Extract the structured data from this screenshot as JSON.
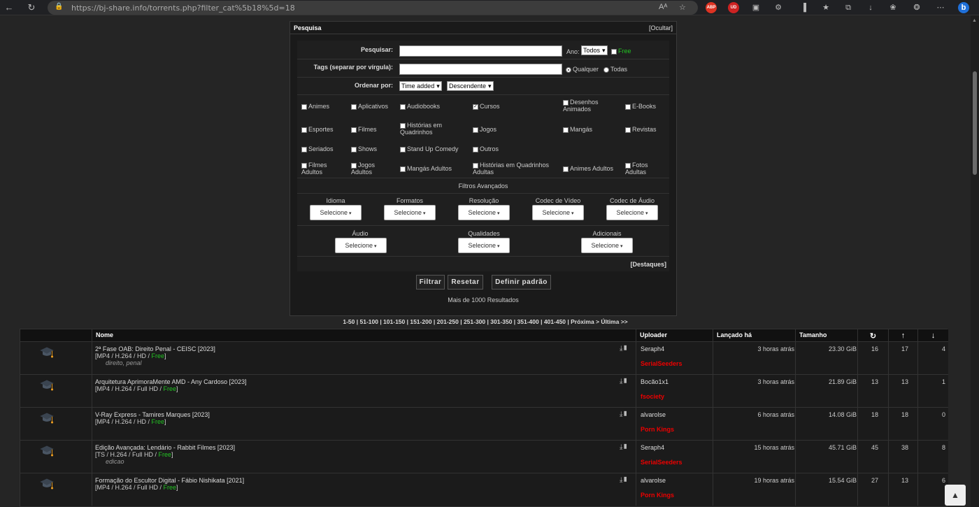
{
  "browser": {
    "url": "https://bj-share.info/torrents.php?filter_cat%5b18%5d=18",
    "back_icon": "←",
    "reload_icon": "↻",
    "lock_icon": "🔒",
    "read_aloud": "Aᴬ",
    "fav_icon": "☆",
    "menu_icon": "⋯",
    "extensions": [
      "ABP",
      "UD",
      "▣",
      "⚙",
      "▐",
      "★",
      "⧉",
      "↓",
      "❀",
      "❂"
    ]
  },
  "search": {
    "title": "Pesquisa",
    "hide": "[Ocultar]",
    "search_label": "Pesquisar:",
    "year_label": "Ano:",
    "year_value": "Todos",
    "free_label": "Free",
    "tags_label": "Tags (separar por vírgula):",
    "any_label": "Qualquer",
    "all_label": "Todas",
    "order_label": "Ordenar por:",
    "order_value": "Time added",
    "dir_value": "Descendente",
    "categories": [
      "Animes",
      "Aplicativos",
      "Audiobooks",
      "Cursos",
      "Desenhos Animados",
      "E-Books",
      "Esportes",
      "Filmes",
      "Histórias em Quadrinhos",
      "Jogos",
      "Mangás",
      "Revistas",
      "Seriados",
      "Shows",
      "Stand Up Comedy",
      "Outros",
      "Filmes Adultos",
      "Jogos Adultos",
      "Mangás Adultos",
      "Histórias em Quadrinhos Adultas",
      "Animes Adultos",
      "Fotos Adultas"
    ],
    "checked": "Cursos",
    "advanced": "Filtros Avançados",
    "filters": [
      "Idioma",
      "Formatos",
      "Resolução",
      "Codec de Vídeo",
      "Codec de Áudio",
      "Áudio",
      "Qualidades",
      "Adicionais"
    ],
    "select_label": "Selecione",
    "highlights": "[Destaques]",
    "filter_btn": "Filtrar",
    "reset_btn": "Resetar",
    "default_btn": "Definir padrão",
    "results": "Mais de 1000 Resultados"
  },
  "pager": "1-50 | 51-100 | 101-150 | 151-200 | 201-250 | 251-300 | 301-350 | 351-400 | 401-450 | Próxima > Última >>",
  "table": {
    "headers": {
      "name": "Nome",
      "uploader": "Uploader",
      "released": "Lançado há",
      "size": "Tamanho",
      "snatched": "↻",
      "seeders": "↑",
      "leechers": "↓"
    },
    "rows": [
      {
        "title": "2ª Fase OAB: Direito Penal - CEISC [2023]",
        "fmt": "[MP4 / H.264 / HD / ",
        "free": "Free",
        "tags": "direito, penal",
        "uploader": "Seraph4",
        "group": "SerialSeeders",
        "when": "3 horas atrás",
        "size": "23.30 GiB",
        "c1": "16",
        "c2": "17",
        "c3": "4"
      },
      {
        "title": "Arquitetura AprimoraMente AMD - Any Cardoso [2023]",
        "fmt": "[MP4 / H.264 / Full HD / ",
        "free": "Free",
        "tags": "",
        "uploader": "Bocão1x1",
        "group": "fsociety",
        "when": "3 horas atrás",
        "size": "21.89 GiB",
        "c1": "13",
        "c2": "13",
        "c3": "1"
      },
      {
        "title": "V-Ray Express - Tamires Marques [2023]",
        "fmt": "[MP4 / H.264 / HD / ",
        "free": "Free",
        "tags": "",
        "uploader": "alvarolse",
        "group": "Porn Kings",
        "when": "6 horas atrás",
        "size": "14.08 GiB",
        "c1": "18",
        "c2": "18",
        "c3": "0"
      },
      {
        "title": "Edição Avançada: Lendário - Rabbit Filmes [2023]",
        "fmt": "[TS / H.264 / Full HD / ",
        "free": "Free",
        "tags": "edicao",
        "uploader": "Seraph4",
        "group": "SerialSeeders",
        "when": "15 horas atrás",
        "size": "45.71 GiB",
        "c1": "45",
        "c2": "38",
        "c3": "8"
      },
      {
        "title": "Formação do Escultor Digital - Fábio Nishikata [2021]",
        "fmt": "[MP4 / H.264 / Full HD / ",
        "free": "Free",
        "tags": "",
        "uploader": "alvarolse",
        "group": "Porn Kings",
        "when": "19 horas atrás",
        "size": "15.54 GiB",
        "c1": "27",
        "c2": "13",
        "c3": "6"
      }
    ]
  },
  "fab_icon": "▲"
}
